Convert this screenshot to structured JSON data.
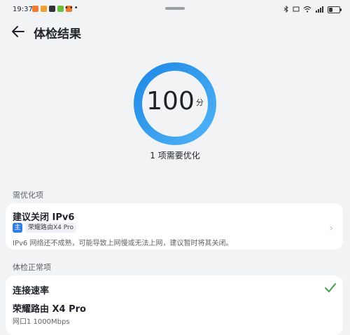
{
  "status_bar": {
    "time": "19:37",
    "dots": "•••",
    "right_icons": [
      "bluetooth-icon",
      "network-type-icon",
      "wifi-icon",
      "signal-icon"
    ],
    "battery_level": 0.35
  },
  "header": {
    "title": "体检结果"
  },
  "score": {
    "value": "100",
    "unit": "分",
    "subtitle": "1 项需要优化",
    "ring_colors": [
      "#1e88e5",
      "#4fb3f6"
    ]
  },
  "optimize_section": {
    "label": "需优化项",
    "items": [
      {
        "title": "建议关闭 IPv6",
        "tag_main": "主",
        "device": "荣耀路由X4 Pro",
        "description": "IPv6 网络还不成熟，可能导致上网慢或无法上网，建议暂时将其关闭。"
      }
    ]
  },
  "normal_section": {
    "label": "体检正常项",
    "items": [
      {
        "title": "连接速率",
        "router_name": "荣耀路由 X4 Pro",
        "port": "网口1 1000Mbps"
      }
    ]
  },
  "colors": {
    "accent": "#2f7de1",
    "check": "#3fa34d",
    "background": "#f1f3f5"
  }
}
